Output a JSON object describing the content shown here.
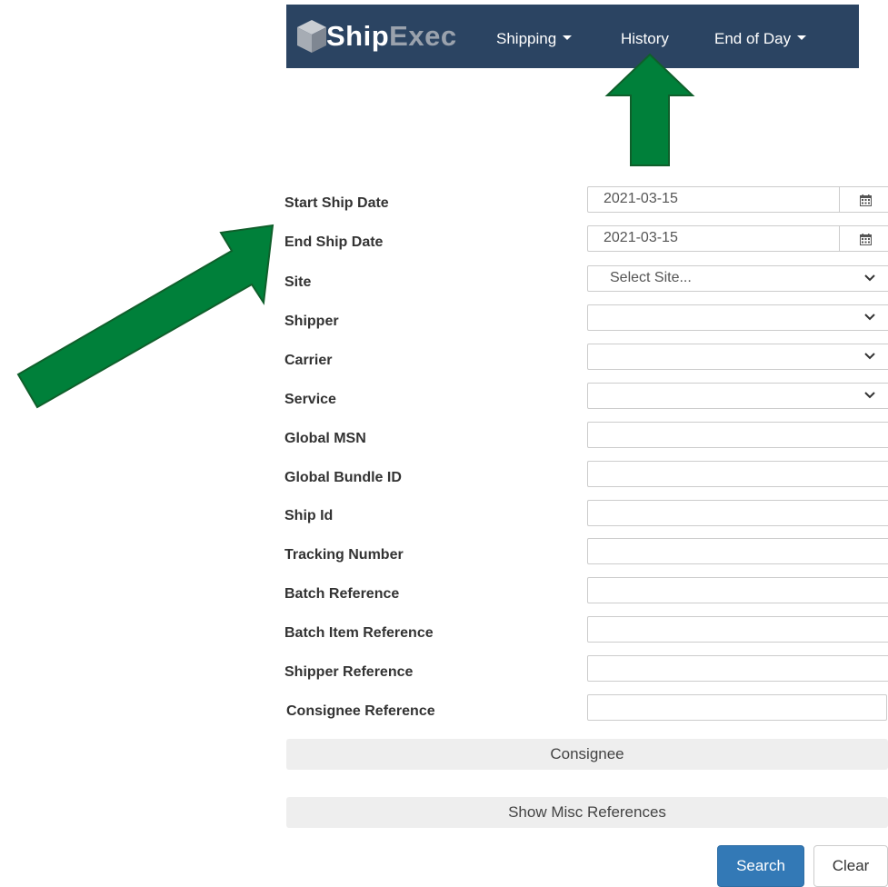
{
  "navbar": {
    "logo_part1": "Ship",
    "logo_part2": "Exec",
    "items": [
      {
        "label": "Shipping",
        "has_dropdown": true
      },
      {
        "label": "History",
        "has_dropdown": false
      },
      {
        "label": "End of Day",
        "has_dropdown": true
      }
    ]
  },
  "form": {
    "start_ship_date": {
      "label": "Start Ship Date",
      "value": "2021-03-15"
    },
    "end_ship_date": {
      "label": "End Ship Date",
      "value": "2021-03-15"
    },
    "site": {
      "label": "Site",
      "value": "Select Site..."
    },
    "shipper": {
      "label": "Shipper",
      "value": ""
    },
    "carrier": {
      "label": "Carrier",
      "value": ""
    },
    "service": {
      "label": "Service",
      "value": ""
    },
    "global_msn": {
      "label": "Global MSN",
      "value": ""
    },
    "global_bundle_id": {
      "label": "Global Bundle ID",
      "value": ""
    },
    "ship_id": {
      "label": "Ship Id",
      "value": ""
    },
    "tracking_number": {
      "label": "Tracking Number",
      "value": ""
    },
    "batch_reference": {
      "label": "Batch Reference",
      "value": ""
    },
    "batch_item_reference": {
      "label": "Batch Item Reference",
      "value": ""
    },
    "shipper_reference": {
      "label": "Shipper Reference",
      "value": ""
    },
    "consignee_reference": {
      "label": "Consignee Reference",
      "value": ""
    }
  },
  "sections": {
    "consignee": "Consignee",
    "misc_references": "Show Misc References"
  },
  "actions": {
    "search": "Search",
    "clear": "Clear"
  },
  "colors": {
    "navbar_bg": "#2b4462",
    "annotation_arrow": "#00803a",
    "primary_button": "#3379b6"
  },
  "icons": {
    "calendar": "calendar-icon",
    "dropdown": "chevron-down-icon",
    "caret": "caret-down-icon"
  }
}
